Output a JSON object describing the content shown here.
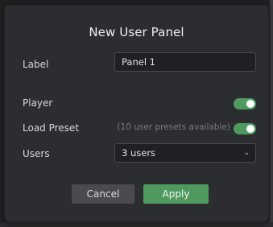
{
  "dialog": {
    "title": "New User Panel",
    "label_field": {
      "label": "Label",
      "value": "Panel 1"
    },
    "player": {
      "label": "Player",
      "enabled": true
    },
    "load_preset": {
      "label": "Load Preset",
      "hint": "(10 user presets available)",
      "enabled": true
    },
    "users": {
      "label": "Users",
      "selected": "3 users"
    },
    "buttons": {
      "cancel": "Cancel",
      "apply": "Apply"
    }
  },
  "colors": {
    "accent": "#4f9a5f",
    "dialog_bg": "#2c2d30",
    "input_bg": "#1f2023"
  }
}
